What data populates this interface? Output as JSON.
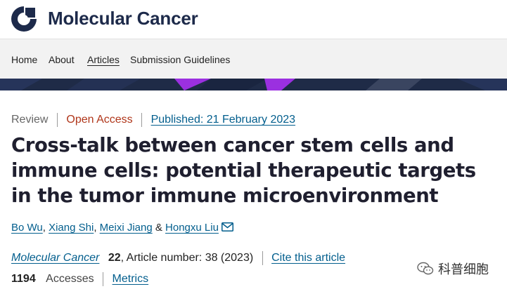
{
  "header": {
    "journal_name": "Molecular Cancer"
  },
  "nav": {
    "items": [
      {
        "label": "Home"
      },
      {
        "label": "About"
      },
      {
        "label": "Articles"
      },
      {
        "label": "Submission Guidelines"
      }
    ],
    "active": "Articles"
  },
  "article": {
    "type": "Review",
    "access": "Open Access",
    "published": "Published: 21 February 2023",
    "title": "Cross-talk between cancer stem cells and immune cells: potential therapeutic targets in the tumor immune microenvironment",
    "authors": [
      "Bo Wu",
      "Xiang Shi",
      "Meixi Jiang",
      "Hongxu Liu"
    ],
    "author_separators": [
      ", ",
      ", ",
      " & "
    ],
    "journal": "Molecular Cancer",
    "volume": "22",
    "article_number": ", Article number: 38 (2023)",
    "cite_label": "Cite this article",
    "accesses_count": "1194",
    "accesses_label": "Accesses",
    "metrics_label": "Metrics"
  },
  "watermark": {
    "text": "科普细胞"
  },
  "colors": {
    "brand_navy": "#1d2a4a",
    "link_blue": "#025e8d",
    "open_access": "#b0361a",
    "banner_dark": "#1f2b47",
    "banner_accent": "#9b30e0"
  },
  "icons": [
    "journal-logo-icon",
    "mail-icon",
    "wechat-icon"
  ]
}
